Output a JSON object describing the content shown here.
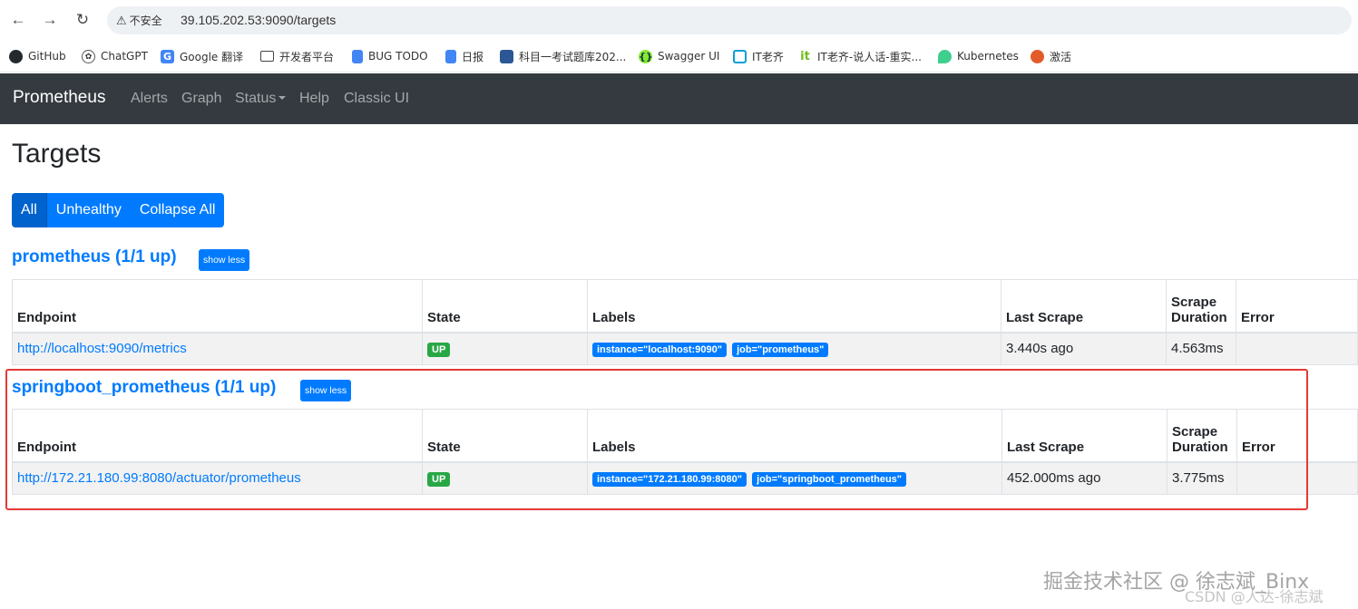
{
  "browser": {
    "security_label": "不安全",
    "url": "39.105.202.53:9090/targets",
    "bookmarks": [
      {
        "label": "GitHub"
      },
      {
        "label": "ChatGPT"
      },
      {
        "label": "Google 翻译"
      },
      {
        "label": "开发者平台"
      },
      {
        "label": "BUG TODO"
      },
      {
        "label": "日报"
      },
      {
        "label": "科目一考试题库202..."
      },
      {
        "label": "Swagger UI"
      },
      {
        "label": "IT老齐"
      },
      {
        "label": "IT老齐-说人话-重实..."
      },
      {
        "label": "Kubernetes"
      },
      {
        "label": "激活"
      }
    ]
  },
  "navbar": {
    "brand": "Prometheus",
    "links": [
      "Alerts",
      "Graph",
      "Status",
      "Help",
      "Classic UI"
    ]
  },
  "page": {
    "title": "Targets",
    "filters": [
      "All",
      "Unhealthy",
      "Collapse All"
    ]
  },
  "columns": [
    "Endpoint",
    "State",
    "Labels",
    "Last Scrape",
    "Scrape Duration",
    "Error"
  ],
  "columns_split": {
    "scrape_top": "Scrape",
    "scrape_bottom": "Duration"
  },
  "jobs": [
    {
      "title": "prometheus (1/1 up)",
      "toggle": "show less",
      "row": {
        "endpoint": "http://localhost:9090/metrics",
        "state": "UP",
        "labels": [
          "instance=\"localhost:9090\"",
          "job=\"prometheus\""
        ],
        "last_scrape": "3.440s ago",
        "duration": "4.563ms",
        "error": ""
      }
    },
    {
      "title": "springboot_prometheus (1/1 up)",
      "toggle": "show less",
      "row": {
        "endpoint": "http://172.21.180.99:8080/actuator/prometheus",
        "state": "UP",
        "labels": [
          "instance=\"172.21.180.99:8080\"",
          "job=\"springboot_prometheus\""
        ],
        "last_scrape": "452.000ms ago",
        "duration": "3.775ms",
        "error": ""
      }
    }
  ],
  "watermark": {
    "line1": "掘金技术社区 @ 徐志斌_Binx",
    "line2": "CSDN @人达-徐志斌"
  },
  "colors": {
    "navbar": "#343a40",
    "primary": "#007bff",
    "success": "#28a745",
    "highlight_box": "#e53935"
  }
}
